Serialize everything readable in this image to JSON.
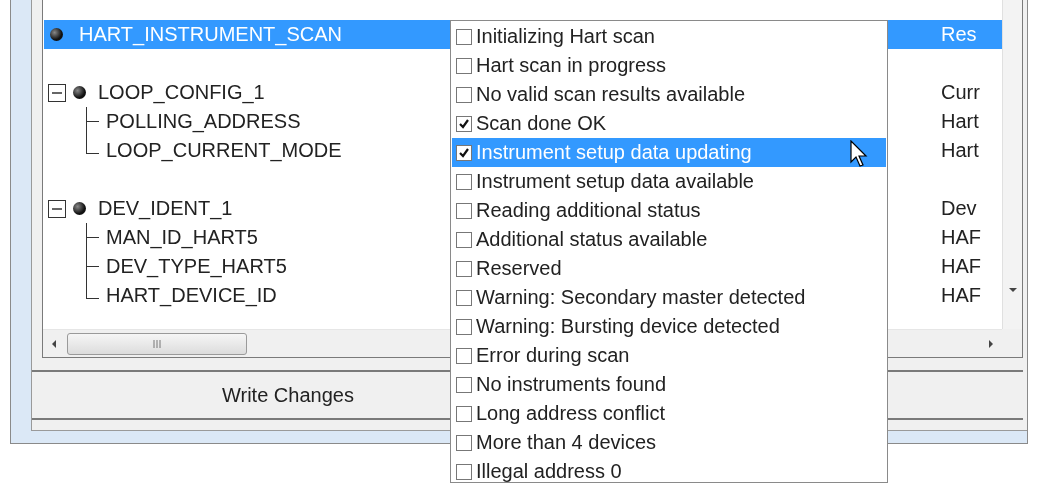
{
  "tree": [
    {
      "name": "HART_INSTRUMENT_SCAN",
      "value": "Res",
      "selected": true
    },
    {
      "name": "LOOP_CONFIG_1",
      "value": "Curr",
      "selected": false,
      "expanded": true,
      "children": [
        {
          "name": "POLLING_ADDRESS",
          "value": "Hart"
        },
        {
          "name": "LOOP_CURRENT_MODE",
          "value": "Hart"
        }
      ]
    },
    {
      "name": "DEV_IDENT_1",
      "value": "Dev",
      "selected": false,
      "expanded": true,
      "children": [
        {
          "name": "MAN_ID_HART5",
          "value": "HAF"
        },
        {
          "name": "DEV_TYPE_HART5",
          "value": "HAF"
        },
        {
          "name": "HART_DEVICE_ID",
          "value": "HAF"
        }
      ]
    }
  ],
  "write_button": "Write Changes",
  "dropdown": [
    {
      "label": "Initializing Hart scan",
      "checked": false,
      "selected": false
    },
    {
      "label": "Hart scan in progress",
      "checked": false,
      "selected": false
    },
    {
      "label": "No valid scan results available",
      "checked": false,
      "selected": false
    },
    {
      "label": "Scan done OK",
      "checked": true,
      "selected": false
    },
    {
      "label": "Instrument setup data updating",
      "checked": true,
      "selected": true
    },
    {
      "label": "Instrument setup data available",
      "checked": false,
      "selected": false
    },
    {
      "label": "Reading additional status",
      "checked": false,
      "selected": false
    },
    {
      "label": "Additional status available",
      "checked": false,
      "selected": false
    },
    {
      "label": "Reserved",
      "checked": false,
      "selected": false
    },
    {
      "label": "Warning: Secondary master detected",
      "checked": false,
      "selected": false
    },
    {
      "label": "Warning: Bursting device detected",
      "checked": false,
      "selected": false
    },
    {
      "label": "Error during scan",
      "checked": false,
      "selected": false
    },
    {
      "label": "No instruments found",
      "checked": false,
      "selected": false
    },
    {
      "label": "Long address conflict",
      "checked": false,
      "selected": false
    },
    {
      "label": "More than 4 devices",
      "checked": false,
      "selected": false
    },
    {
      "label": "Illegal address 0",
      "checked": false,
      "selected": false
    }
  ]
}
